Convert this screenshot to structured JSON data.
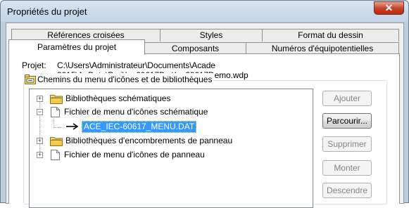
{
  "window": {
    "title": "Propriétés du projet",
    "close_symbol": "✕"
  },
  "tabs": {
    "row_back": [
      "Références croisées",
      "Styles",
      "Format du dessin"
    ],
    "row_front": [
      "Paramètres du projet",
      "Composants",
      "Numéros d'équipotentielles"
    ],
    "active": "Paramètres du projet"
  },
  "project": {
    "label": "Projet:",
    "path": "C:\\Users\\Administrateur\\Documents\\Acade 2015\\AeData\\Proj\\Iec60617D...\\Iec60617Demo.wdp"
  },
  "group": {
    "title": "Chemins du menu d'icônes et de bibliothèques",
    "icon": "folder-library-icon"
  },
  "tree": {
    "nodes": [
      {
        "label": "Bibliothèques schématiques",
        "icon": "folder-icon",
        "expander": "+"
      },
      {
        "label": "Fichier de menu d'icônes schématique",
        "icon": "document-icon",
        "expander": "−"
      },
      {
        "label": "ACE_IEC-60617_MENU.DAT",
        "icon": "arrow-icon",
        "selected": true
      },
      {
        "label": "Bibliothèques d'encombrements de panneau",
        "icon": "folder-icon",
        "expander": "+"
      },
      {
        "label": "Fichier de menu d'icônes de panneau",
        "icon": "document-icon",
        "expander": "+"
      }
    ]
  },
  "buttons": {
    "ajouter": "Ajouter",
    "parcourir": "Parcourir...",
    "supprimer": "Supprimer",
    "monter": "Monter",
    "descendre": "Descendre"
  },
  "colors": {
    "selection": "#3399ff",
    "close_button": "#c7452c",
    "titlebar": "#c2d4e7"
  }
}
